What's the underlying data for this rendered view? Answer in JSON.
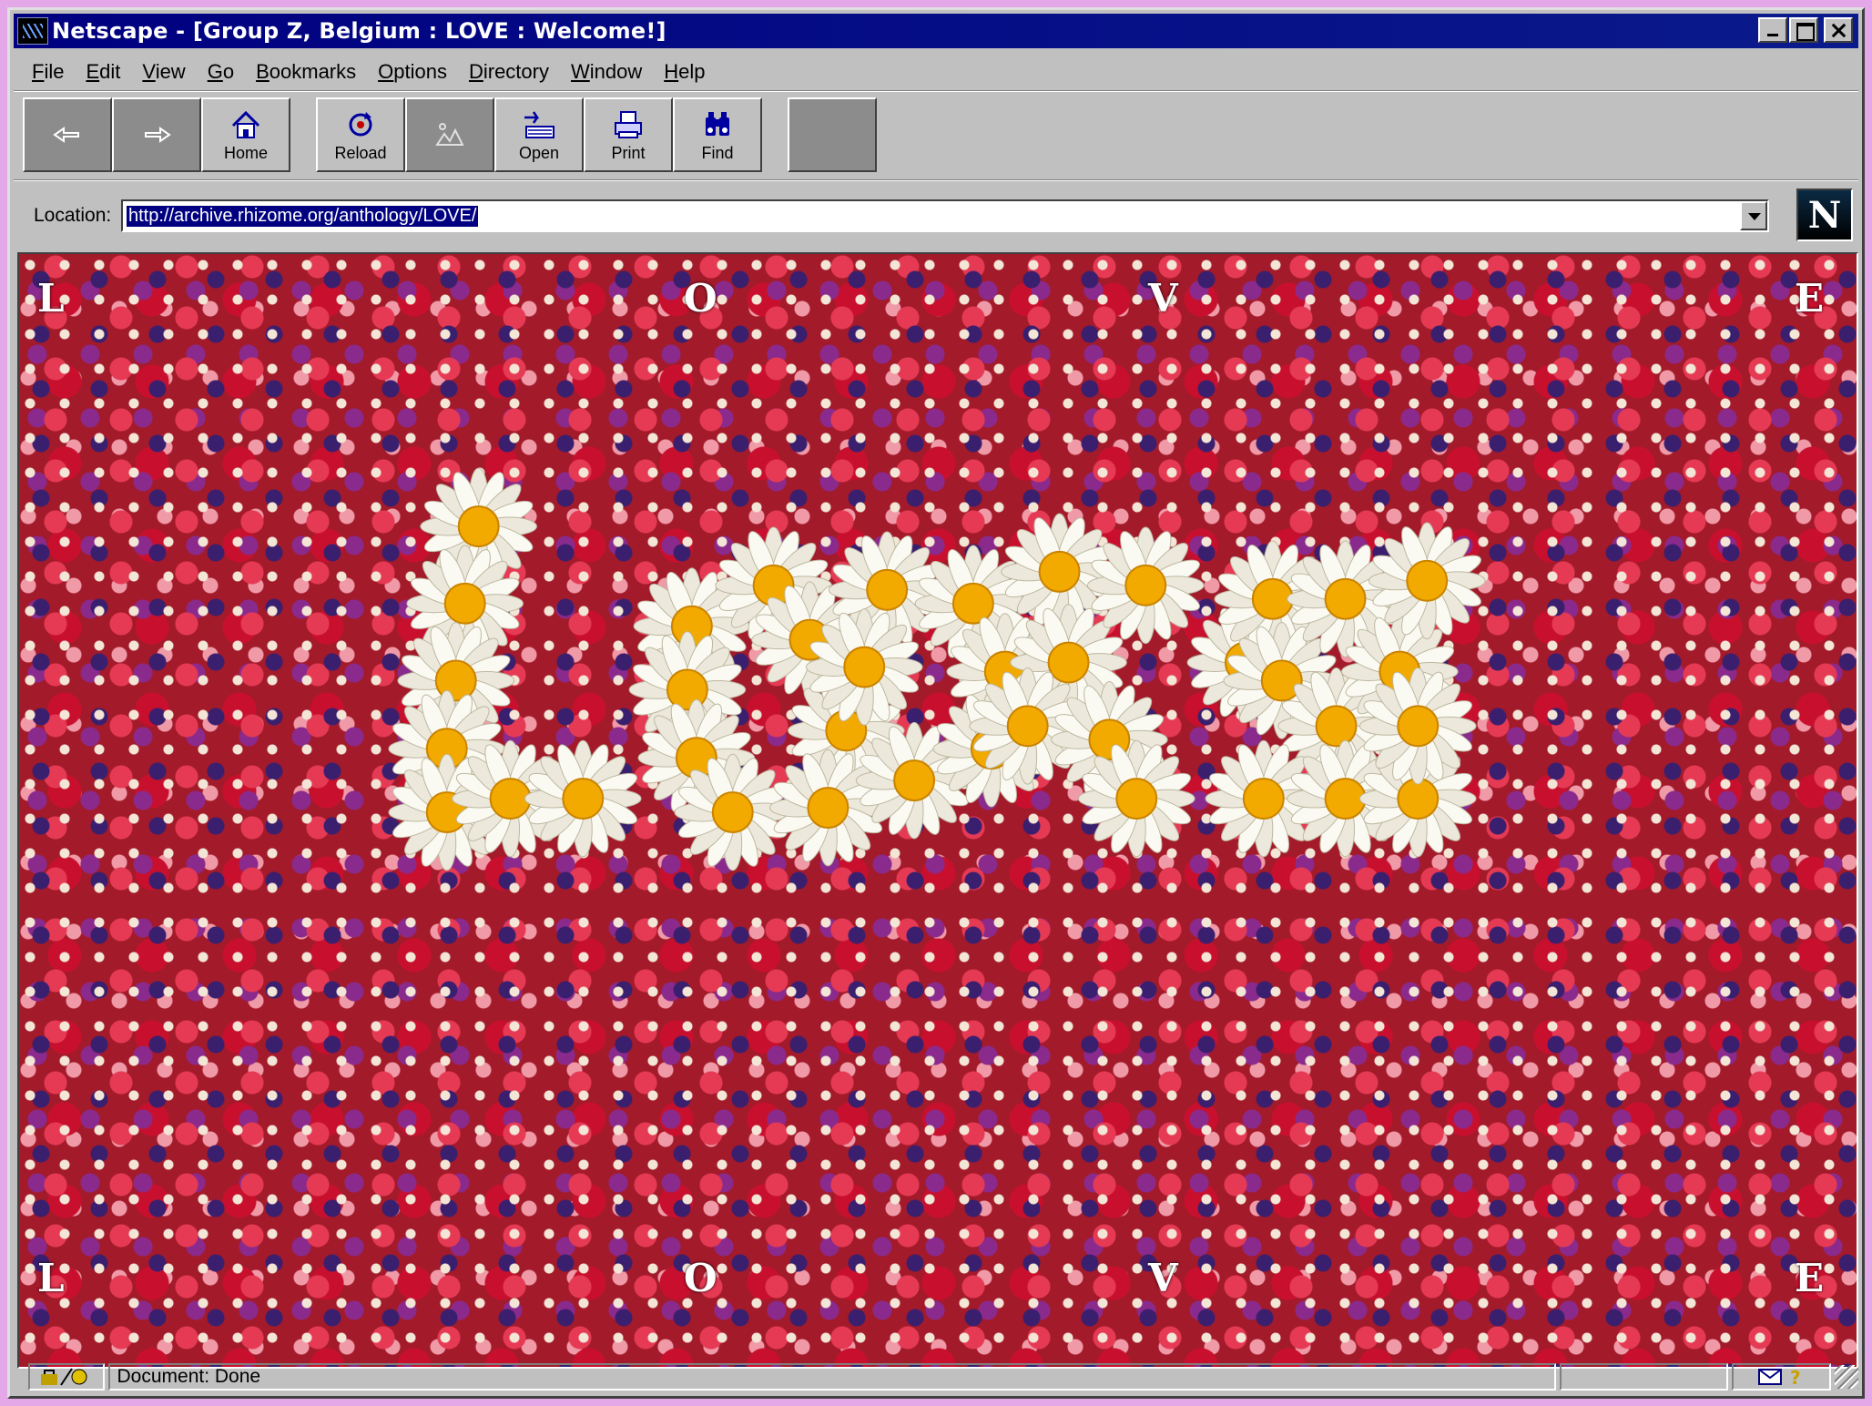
{
  "window": {
    "title": "Netscape - [Group Z, Belgium : LOVE : Welcome!]"
  },
  "menubar": {
    "items": [
      {
        "label": "File",
        "accel": "F"
      },
      {
        "label": "Edit",
        "accel": "E"
      },
      {
        "label": "View",
        "accel": "V"
      },
      {
        "label": "Go",
        "accel": "G"
      },
      {
        "label": "Bookmarks",
        "accel": "B"
      },
      {
        "label": "Options",
        "accel": "O"
      },
      {
        "label": "Directory",
        "accel": "D"
      },
      {
        "label": "Window",
        "accel": "W"
      },
      {
        "label": "Help",
        "accel": "H"
      }
    ]
  },
  "toolbar": {
    "back_icon": "back-arrow-icon",
    "forward_icon": "forward-arrow-icon",
    "home_label": "Home",
    "reload_label": "Reload",
    "images_icon": "images-icon",
    "open_label": "Open",
    "print_label": "Print",
    "find_label": "Find",
    "stop_icon": "stop-icon"
  },
  "location": {
    "label": "Location:",
    "url": "http://archive.rhizome.org/anthology/LOVE/"
  },
  "content": {
    "letters_top": [
      "L",
      "O",
      "V",
      "E"
    ],
    "letters_bottom": [
      "L",
      "O",
      "V",
      "E"
    ],
    "daisy_word": "LOVE"
  },
  "statusbar": {
    "text": "Document: Done",
    "mail_icon": "mail-icon",
    "help_icon": "question-icon"
  },
  "colors": {
    "titlebar": "#000080",
    "chrome": "#c0c0c0",
    "selection": "#000080"
  }
}
